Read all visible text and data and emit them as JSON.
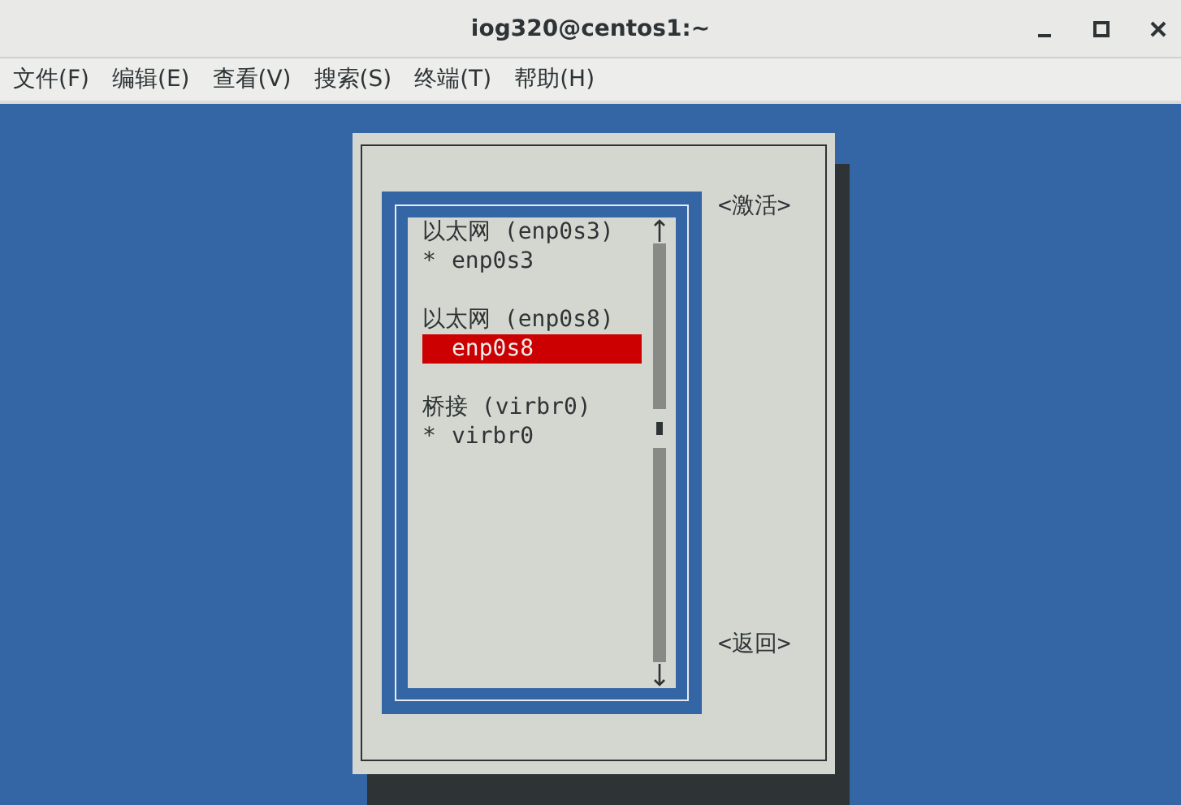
{
  "window": {
    "title": "iog320@centos1:~"
  },
  "menu": [
    "文件(F)",
    "编辑(E)",
    "查看(V)",
    "搜索(S)",
    "终端(T)",
    "帮助(H)"
  ],
  "connections": [
    {
      "header": "以太网 (enp0s3)",
      "entries": [
        {
          "marker": "*",
          "name": "enp0s3",
          "selected": false
        }
      ]
    },
    {
      "header": "以太网 (enp0s8)",
      "entries": [
        {
          "name": "enp0s8",
          "selected": true
        }
      ]
    },
    {
      "header": "桥接 (virbr0)",
      "entries": [
        {
          "marker": "*",
          "name": "virbr0",
          "selected": false
        }
      ]
    }
  ],
  "buttons": [
    "<激活>",
    "<返回>"
  ]
}
